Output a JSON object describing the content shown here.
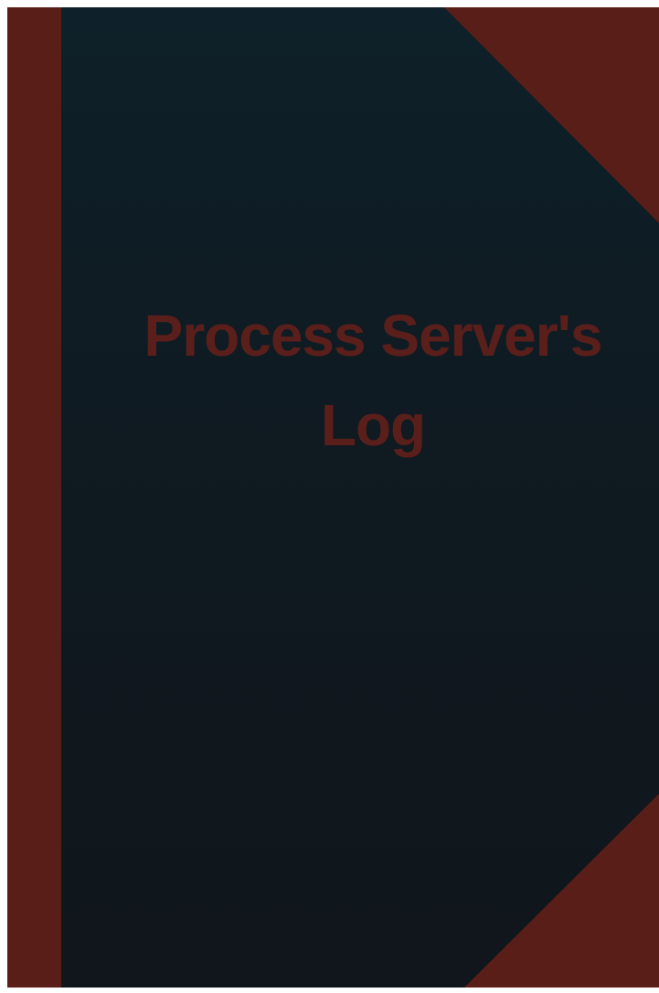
{
  "cover": {
    "title_line1": "Process Server's",
    "title_line2": "Log",
    "colors": {
      "board": "#0f1c23",
      "accent": "#5a1e19",
      "title": "#5b1f1b"
    }
  }
}
